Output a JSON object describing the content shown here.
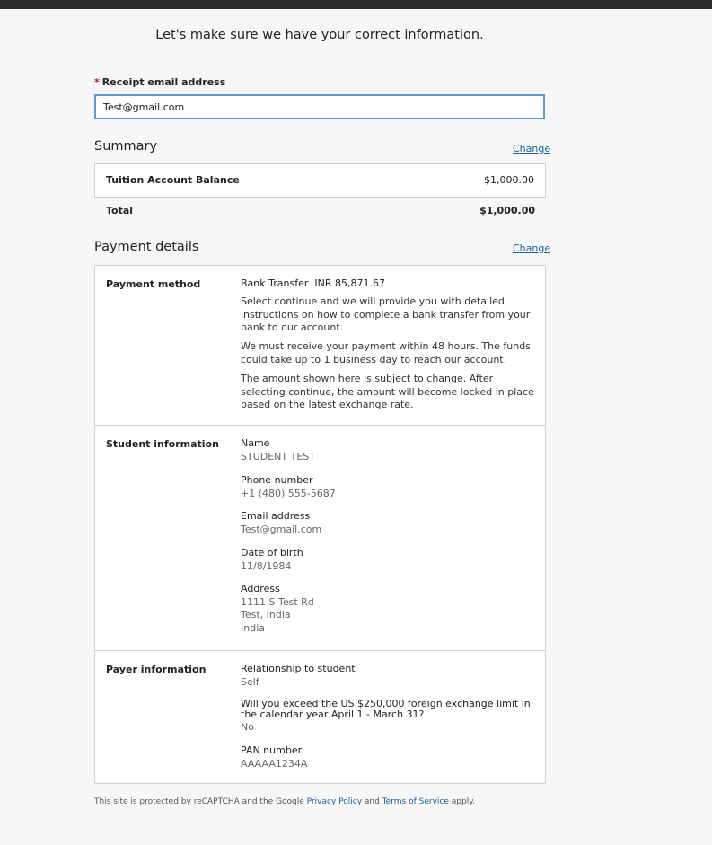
{
  "heading": "Let's make sure we have your correct information.",
  "email": {
    "required_mark": "*",
    "label": "Receipt email address",
    "value": "Test@gmail.com"
  },
  "summary": {
    "title": "Summary",
    "change_label": "Change",
    "item_label": "Tuition Account Balance",
    "item_value": "$1,000.00",
    "total_label": "Total",
    "total_value": "$1,000.00"
  },
  "payment_details": {
    "title": "Payment details",
    "change_label": "Change",
    "method": {
      "title": "Payment method",
      "name": "Bank Transfer",
      "amount": "INR 85,871.67",
      "paragraphs": [
        "Select continue and we will provide you with detailed instructions on how to complete a bank transfer from your bank to our account.",
        "We must receive your payment within 48 hours. The funds could take up to 1 business day to reach our account.",
        "The amount shown here is subject to change. After selecting continue, the amount will become locked in place based on the latest exchange rate."
      ]
    },
    "student": {
      "title": "Student information",
      "name_label": "Name",
      "name_value": "STUDENT TEST",
      "phone_label": "Phone number",
      "phone_value": "+1 (480) 555-5687",
      "email_label": "Email address",
      "email_value": "Test@gmail.com",
      "dob_label": "Date of birth",
      "dob_value": "11/8/1984",
      "address_label": "Address",
      "address_line1": "1111 S Test Rd",
      "address_line2": "Test, India",
      "address_line3": "India"
    },
    "payer": {
      "title": "Payer information",
      "relationship_label": "Relationship to student",
      "relationship_value": "Self",
      "exchange_label": "Will you exceed the US $250,000 foreign exchange limit in the calendar year April 1 - March 31?",
      "exchange_value": "No",
      "pan_label": "PAN number",
      "pan_value": "AAAAA1234A"
    }
  },
  "footer": {
    "prefix": "This site is protected by reCAPTCHA and the Google",
    "privacy": "Privacy Policy",
    "and": "and",
    "terms": "Terms of Service",
    "suffix": "apply."
  }
}
